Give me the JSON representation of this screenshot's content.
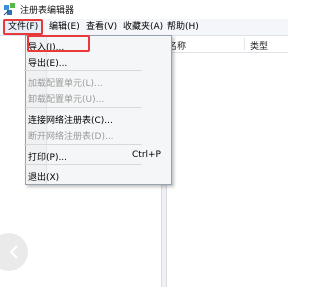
{
  "window": {
    "title": "注册表编辑器"
  },
  "menubar": {
    "file": "文件(F)",
    "edit": "编辑(E)",
    "view": "查看(V)",
    "favorites": "收藏夹(A)",
    "help": "帮助(H)"
  },
  "list": {
    "col_name": "名称",
    "col_type": "类型"
  },
  "file_menu": {
    "import": "导入(I)...",
    "export": "导出(E)...",
    "load_hive": "加载配置单元(L)...",
    "unload_hive": "卸载配置单元(U)...",
    "connect": "连接网络注册表(C)...",
    "disconnect": "断开网络注册表(D)...",
    "print": "打印(P)...",
    "print_shortcut": "Ctrl+P",
    "exit": "退出(X)"
  },
  "colors": {
    "highlight": "#e83a3a",
    "menubar_bg": "#f4f6fa"
  },
  "icons": {
    "app": "registry-editor-icon",
    "nav": "back-arrow-icon"
  }
}
